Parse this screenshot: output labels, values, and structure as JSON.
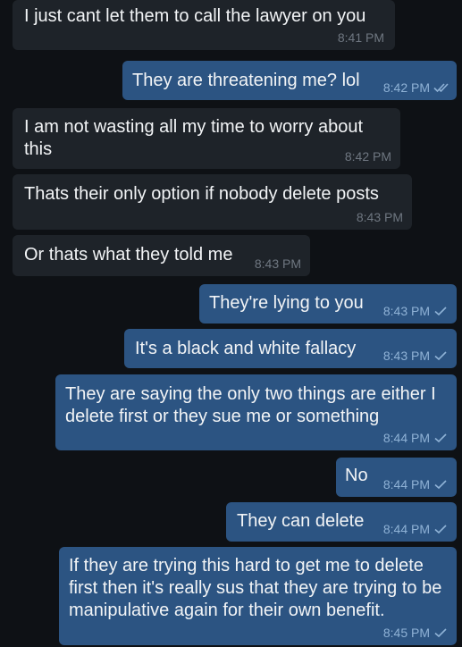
{
  "colors": {
    "background": "#0e1115",
    "incoming_bubble": "#1e2329",
    "outgoing_bubble": "#2c5482",
    "incoming_time": "#6f7781",
    "outgoing_time": "#8fb2d6"
  },
  "messages": [
    {
      "direction": "in",
      "text": "I just cant let them to call the lawyer on you",
      "time": "8:41 PM"
    },
    {
      "direction": "out",
      "text": "They are threatening me? lol",
      "time": "8:42 PM",
      "status": "read",
      "status_icon": "double-check-icon"
    },
    {
      "direction": "in",
      "text": "I am not wasting all my time to worry about this",
      "time": "8:42 PM"
    },
    {
      "direction": "in",
      "text": "Thats their only option if nobody delete posts",
      "time": "8:43 PM"
    },
    {
      "direction": "in",
      "text": "Or thats what they told me",
      "time": "8:43 PM"
    },
    {
      "direction": "out",
      "text": "They're lying to you",
      "time": "8:43 PM",
      "status": "sent",
      "status_icon": "check-icon"
    },
    {
      "direction": "out",
      "text": "It's a black and white fallacy",
      "time": "8:43 PM",
      "status": "sent",
      "status_icon": "check-icon"
    },
    {
      "direction": "out",
      "text": "They are saying the only two things are either I delete first or they sue me or something",
      "time": "8:44 PM",
      "status": "sent",
      "status_icon": "check-icon"
    },
    {
      "direction": "out",
      "text": "No",
      "time": "8:44 PM",
      "status": "sent",
      "status_icon": "check-icon"
    },
    {
      "direction": "out",
      "text": "They can delete",
      "time": "8:44 PM",
      "status": "sent",
      "status_icon": "check-icon"
    },
    {
      "direction": "out",
      "text": "If they are trying this hard to get me to delete first then it's really sus that they are trying to be manipulative again for their own benefit.",
      "time": "8:45 PM",
      "status": "sent",
      "status_icon": "check-icon"
    }
  ]
}
